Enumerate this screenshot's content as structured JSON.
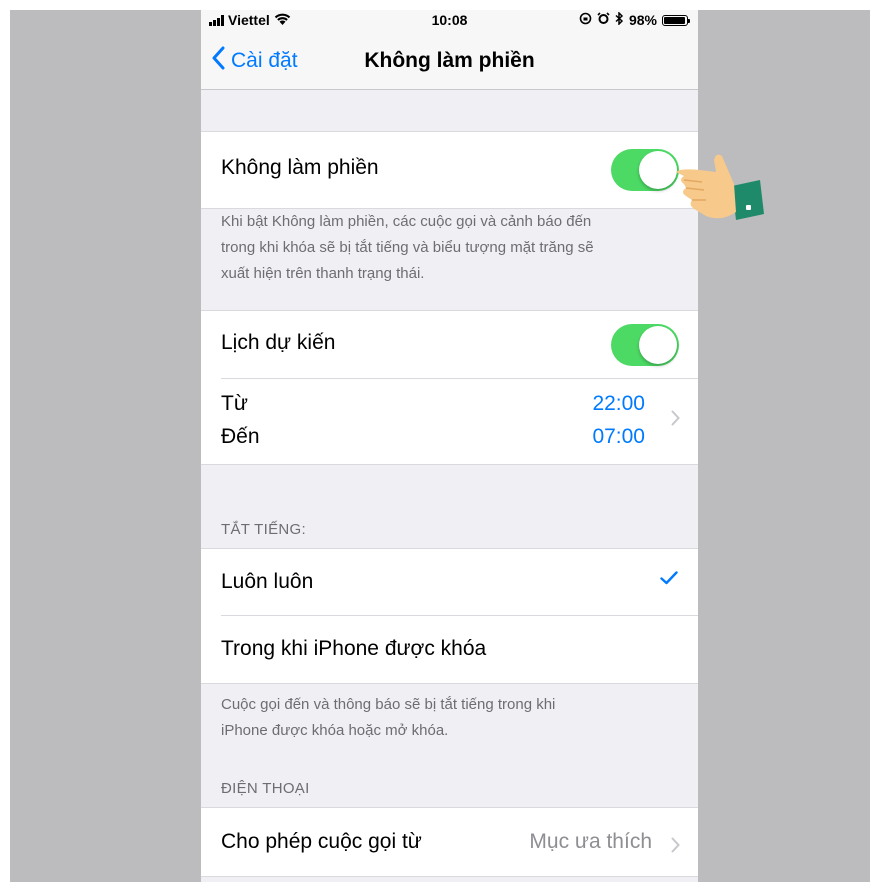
{
  "status_bar": {
    "carrier": "Viettel",
    "time": "10:08",
    "battery": "98%"
  },
  "nav": {
    "back_label": "Cài đặt",
    "title": "Không làm phiền"
  },
  "dnd": {
    "label": "Không làm phiền",
    "enabled": true,
    "footer": [
      "Khi bật Không làm phiền, các cuộc gọi và cảnh báo đến",
      "trong khi khóa sẽ bị tắt tiếng và biểu tượng mặt trăng sẽ",
      "xuất hiện trên thanh trạng thái."
    ]
  },
  "schedule": {
    "label": "Lịch dự kiến",
    "enabled": true,
    "from_label": "Từ",
    "from_value": "22:00",
    "to_label": "Đến",
    "to_value": "07:00"
  },
  "silence": {
    "header": "TẮT TIẾNG:",
    "options": [
      {
        "label": "Luôn luôn",
        "selected": true
      },
      {
        "label": "Trong khi iPhone được khóa",
        "selected": false
      }
    ],
    "footer": [
      "Cuộc gọi đến và thông báo sẽ bị tắt tiếng trong khi",
      "iPhone được khóa hoặc mở khóa."
    ]
  },
  "phone": {
    "header": "ĐIỆN THOẠI",
    "allow_calls_label": "Cho phép cuộc gọi từ",
    "allow_calls_value": "Mục ưa thích"
  },
  "colors": {
    "accent": "#007aff",
    "toggle_on": "#4cd964",
    "group_background": "#efeff4",
    "backdrop": "#bcbbbd"
  }
}
